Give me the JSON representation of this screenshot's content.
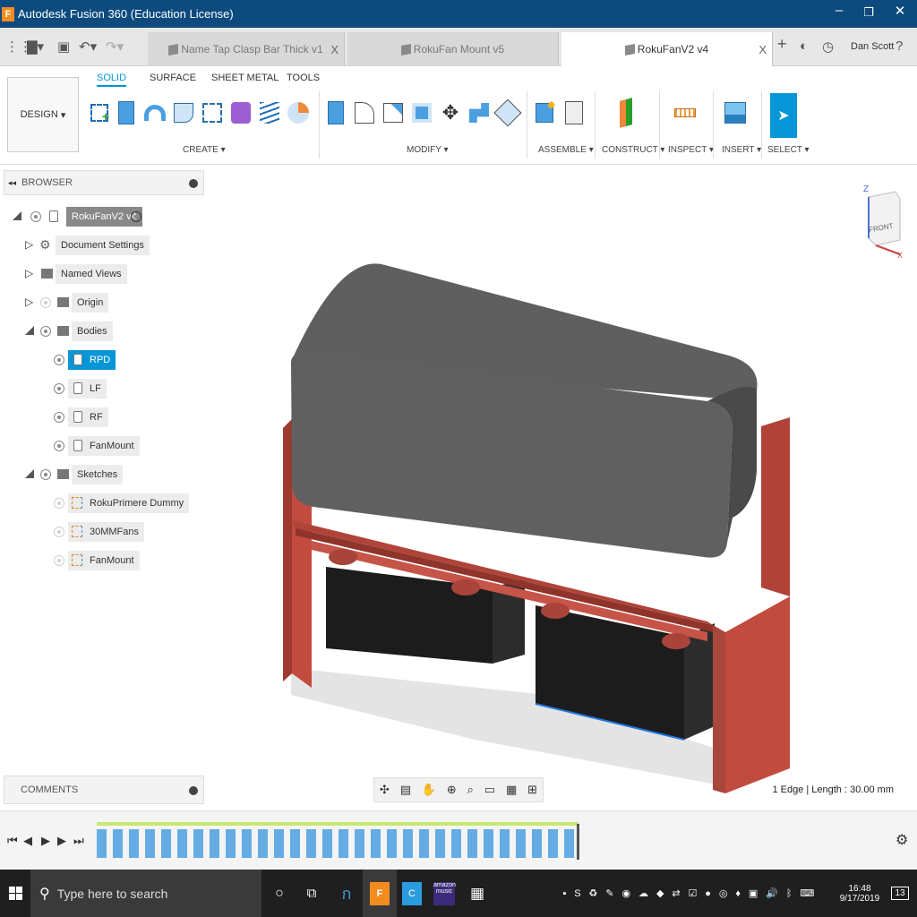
{
  "window": {
    "title": "Autodesk Fusion 360 (Education License)",
    "minimize": "–",
    "maximize": "❐",
    "close": "✕"
  },
  "tabs": [
    {
      "label": "Name Tap Clasp Bar Thick v1",
      "close": "X"
    },
    {
      "label": "RokuFan Mount v5",
      "close": ""
    },
    {
      "label": "RokuFanV2 v4",
      "close": "X"
    }
  ],
  "user": {
    "name": "Dan Scott"
  },
  "workspace": {
    "label": "DESIGN",
    "arrow": "▾"
  },
  "ribbon_tabs": [
    "SOLID",
    "SURFACE",
    "SHEET METAL",
    "TOOLS"
  ],
  "ribbon_groups": [
    "CREATE ▾",
    "MODIFY ▾",
    "ASSEMBLE ▾",
    "CONSTRUCT ▾",
    "INSPECT ▾",
    "INSERT ▾",
    "SELECT ▾"
  ],
  "browser": {
    "title": "BROWSER",
    "root": "RokuFanV2 v4",
    "items": [
      {
        "label": "Document Settings"
      },
      {
        "label": "Named Views"
      },
      {
        "label": "Origin"
      },
      {
        "label": "Bodies"
      },
      {
        "label": "RPD"
      },
      {
        "label": "LF"
      },
      {
        "label": "RF"
      },
      {
        "label": "FanMount"
      },
      {
        "label": "Sketches"
      },
      {
        "label": "RokuPrimere Dummy"
      },
      {
        "label": "30MMFans"
      },
      {
        "label": "FanMount"
      }
    ]
  },
  "comments": {
    "title": "COMMENTS"
  },
  "viewcube": {
    "face": "FRONT",
    "z": "Z",
    "x": "X"
  },
  "status": {
    "text": "1 Edge | Length : 30.00 mm"
  },
  "taskbar": {
    "search_placeholder": "Type here to search",
    "time": "16:48",
    "date": "9/17/2019",
    "notification_count": "13",
    "amazon_label": "amazon music"
  },
  "colors": {
    "titlebar": "#0d4b7e",
    "accent": "#0696d7",
    "model_red": "#b5463b",
    "model_gray": "#5c5c5c"
  }
}
